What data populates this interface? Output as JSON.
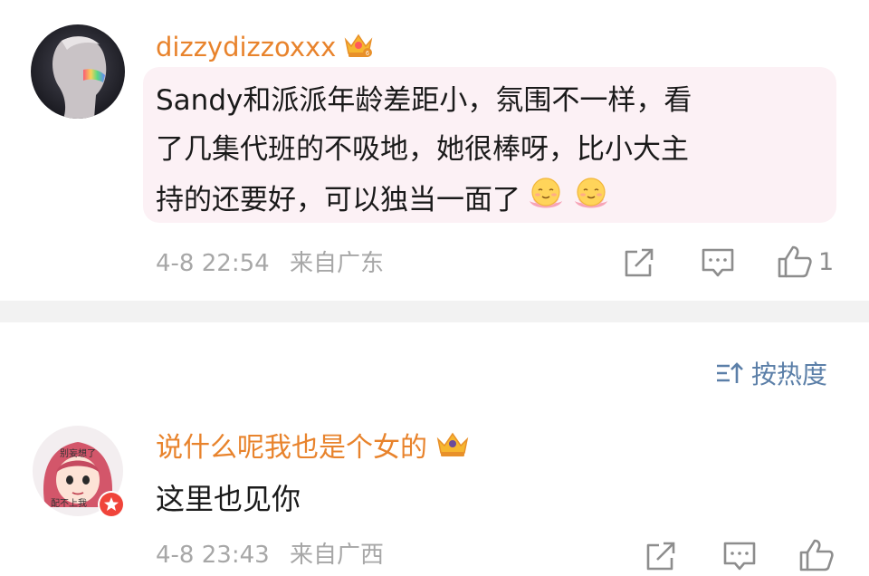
{
  "comments": [
    {
      "username": "dizzydizzoxxx",
      "badge_icon": "crown-badge-icon",
      "content_lines": [
        "Sandy和派派年龄差距小，氛围不一样，看",
        "了几集代班的不吸地，她很棒呀，比小大主",
        "持的还要好，可以独当一面了"
      ],
      "emojis": [
        "smiling-lotus-emoji",
        "smiling-lotus-emoji"
      ],
      "date": "4-8 22:54",
      "source": "来自广东",
      "like_count": "1"
    },
    {
      "username": "说什么呢我也是个女的",
      "badge_icon": "crown-badge-icon",
      "avatar_text_top": "别妄想了",
      "avatar_text_bottom": "配不上我",
      "content": "这里也见你",
      "date": "4-8 23:43",
      "source": "来自广西"
    }
  ],
  "sort": {
    "label": "按热度",
    "icon": "sort-icon"
  },
  "colors": {
    "username": "#e8832c",
    "bubble": "#fcf1f5",
    "meta": "#a7a7a7",
    "sort": "#5b7fa8",
    "divider": "#f2f2f2"
  }
}
